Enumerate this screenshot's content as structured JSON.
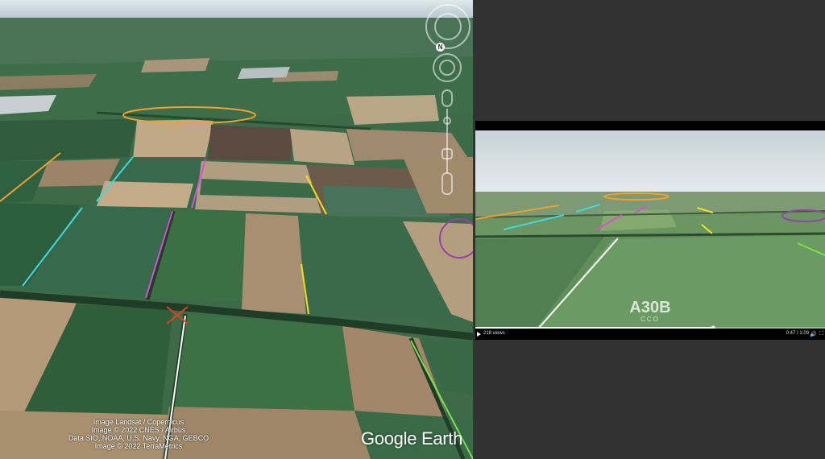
{
  "earth": {
    "credits": [
      "Image Landsat / Copernicus",
      "Image © 2022 CNES / Airbus",
      "Data SIO, NOAA, U.S. Navy, NGA, GEBCO",
      "Image © 2022 TerraMetrics"
    ],
    "logo": "Google Earth",
    "compass_label": "N"
  },
  "video": {
    "views": "218 views",
    "time": "0:47 / 1:09",
    "progress": 0.68,
    "watermark_main": "A30B",
    "watermark_sub": "CCO"
  },
  "colors": {
    "orange": "#f0a030",
    "cyan": "#3fd8e0",
    "magenta": "#d84fd8",
    "yellow": "#f0e020",
    "white": "#ffffff",
    "green": "#7ce050",
    "purple": "#9b3fa8",
    "red": "#e04020"
  }
}
